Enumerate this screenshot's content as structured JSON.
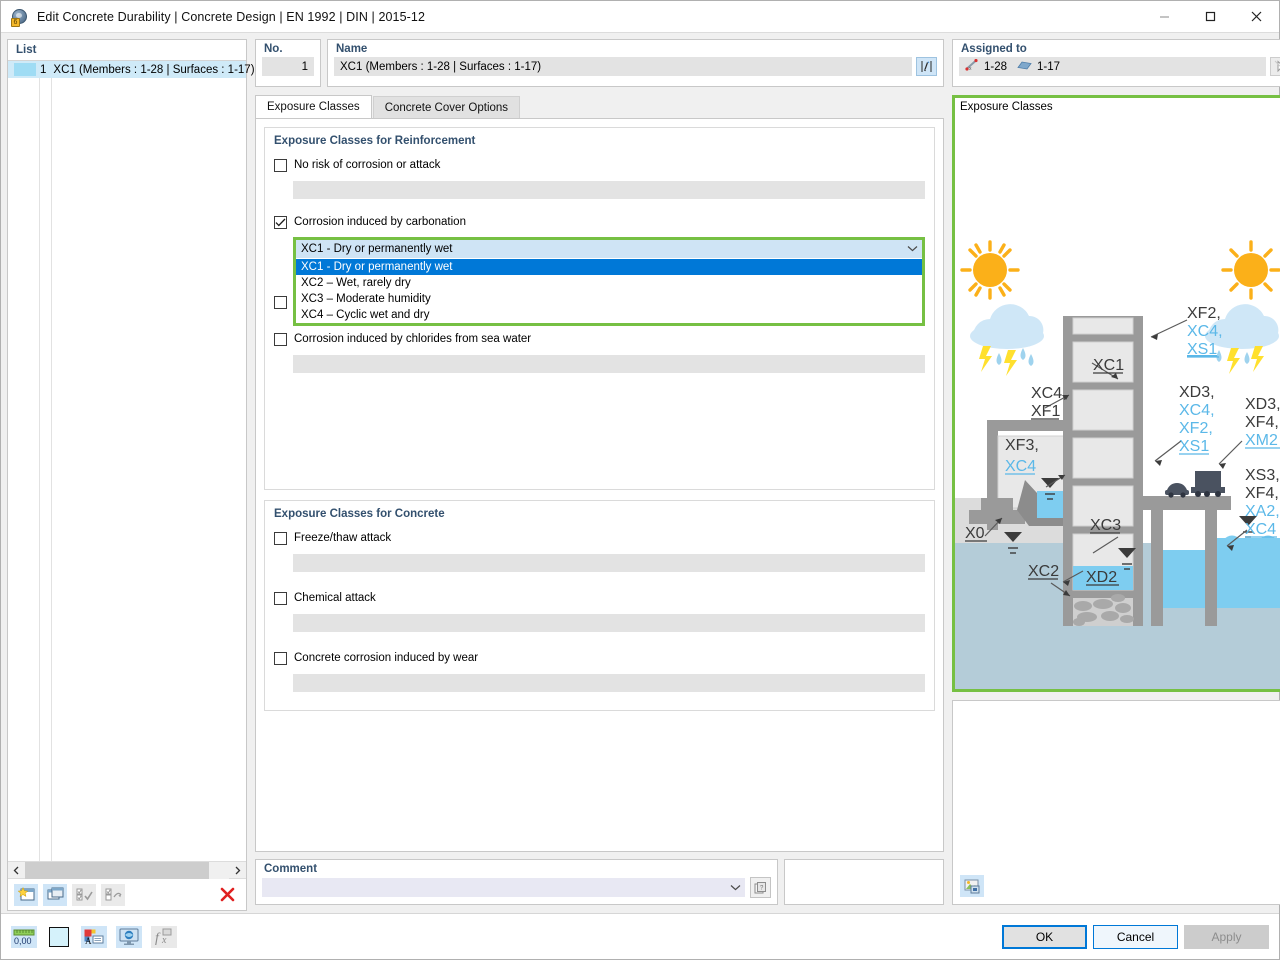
{
  "window": {
    "title": "Edit Concrete Durability | Concrete Design | EN 1992 | DIN | 2015-12",
    "icon": "app-sphere-icon",
    "minimize": "minimize-icon",
    "maximize": "maximize-icon",
    "close": "close-icon"
  },
  "list_panel": {
    "header": "List",
    "rows": [
      {
        "number": "1",
        "label": "XC1 (Members : 1-28 | Surfaces : 1-17)"
      }
    ],
    "toolbar": {
      "new_label": "new-item",
      "copy_label": "copy-item",
      "select_all_label": "select-all",
      "deselect_label": "deselect",
      "delete_label": "delete-item"
    }
  },
  "no_field": {
    "label": "No.",
    "value": "1"
  },
  "name_field": {
    "label": "Name",
    "value": "XC1 (Members : 1-28 | Surfaces : 1-17)",
    "edit_button": "edit-name-icon"
  },
  "assigned": {
    "label": "Assigned to",
    "members": "1-28",
    "surfaces": "1-17",
    "pick_button": "pick-in-model-icon"
  },
  "tabs": [
    {
      "label": "Exposure Classes",
      "active": true
    },
    {
      "label": "Concrete Cover Options",
      "active": false
    }
  ],
  "reinforcement": {
    "title": "Exposure Classes for Reinforcement",
    "items": [
      {
        "label": "No risk of corrosion or attack",
        "checked": false,
        "field": ""
      },
      {
        "label": "Corrosion induced by carbonation",
        "checked": true
      },
      {
        "label": "Corrosion induced by chlorides from sea water",
        "checked": false,
        "field": ""
      }
    ]
  },
  "carbonation_combo": {
    "value": "XC1 - Dry or permanently wet",
    "options": [
      "XC1 - Dry or permanently wet",
      "XC2 – Wet, rarely dry",
      "XC3 – Moderate humidity",
      "XC4 – Cyclic wet and dry"
    ],
    "selected_index": 0,
    "chevron": "chevron-down-icon",
    "highlight_color": "#76c043"
  },
  "concrete": {
    "title": "Exposure Classes for Concrete",
    "items": [
      {
        "label": "Freeze/thaw attack",
        "checked": false,
        "field": ""
      },
      {
        "label": "Chemical attack",
        "checked": false,
        "field": ""
      },
      {
        "label": "Concrete corrosion induced by wear",
        "checked": false,
        "field": ""
      }
    ]
  },
  "comment": {
    "label": "Comment",
    "value": "",
    "placeholder": "",
    "chevron": "chevron-down-icon",
    "button": "comment-library-icon"
  },
  "image_panel": {
    "title": "Exposure Classes",
    "border_color": "#76c043",
    "labels": [
      {
        "id": "xf2-group",
        "lines": [
          "XF2,",
          "XC4,",
          "XS1"
        ],
        "colors": [
          "#3b3b3b",
          "#5bb8e8",
          "#5bb8e8"
        ]
      },
      {
        "id": "xc1",
        "lines": [
          "XC1"
        ],
        "colors": [
          "#3b3b3b"
        ]
      },
      {
        "id": "xc4-xf1",
        "lines": [
          "XC4,",
          "XF1"
        ],
        "colors": [
          "#3b3b3b",
          "#3b3b3b"
        ]
      },
      {
        "id": "xf3-xc4",
        "lines": [
          "XF3,",
          "XC4"
        ],
        "colors": [
          "#3b3b3b",
          "#5bb8e8"
        ]
      },
      {
        "id": "x0",
        "lines": [
          "X0"
        ],
        "colors": [
          "#3b3b3b"
        ]
      },
      {
        "id": "xc2",
        "lines": [
          "XC2"
        ],
        "colors": [
          "#3b3b3b"
        ]
      },
      {
        "id": "xc3",
        "lines": [
          "XC3"
        ],
        "colors": [
          "#3b3b3b"
        ]
      },
      {
        "id": "xd2",
        "lines": [
          "XD2"
        ],
        "colors": [
          "#3b3b3b"
        ]
      },
      {
        "id": "xd3-group",
        "lines": [
          "XD3,",
          "XC4,",
          "XF2,",
          "XS1"
        ],
        "colors": [
          "#3b3b3b",
          "#5bb8e8",
          "#5bb8e8",
          "#5bb8e8"
        ]
      },
      {
        "id": "xd3-xf4-xm2",
        "lines": [
          "XD3,",
          "XF4,",
          "XM2"
        ],
        "colors": [
          "#3b3b3b",
          "#3b3b3b",
          "#5bb8e8"
        ]
      },
      {
        "id": "xs3-group",
        "lines": [
          "XS3,",
          "XF4,",
          "XA2,",
          "XC4"
        ],
        "colors": [
          "#3b3b3b",
          "#3b3b3b",
          "#5bb8e8",
          "#5bb8e8"
        ]
      }
    ],
    "export_button": "export-image-icon"
  },
  "footer": {
    "tools": [
      {
        "name": "units-icon",
        "label": "0,00"
      },
      {
        "name": "color-swatch-icon",
        "label": ""
      },
      {
        "name": "text-settings-icon",
        "label": ""
      },
      {
        "name": "display-settings-icon",
        "label": ""
      },
      {
        "name": "formula-icon",
        "label": ""
      }
    ],
    "ok": "OK",
    "cancel": "Cancel",
    "apply": "Apply"
  }
}
